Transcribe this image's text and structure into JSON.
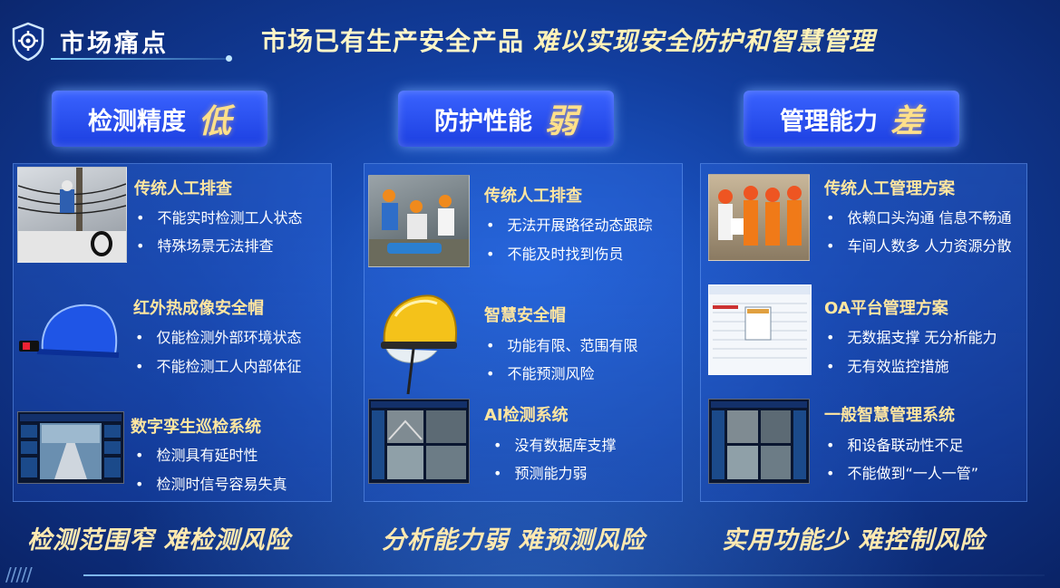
{
  "header": {
    "section_title": "市场痛点",
    "headline_a": "市场已有生产安全产品",
    "headline_b": "难以实现安全防护和智慧管理"
  },
  "columns": [
    {
      "title": "检测精度",
      "accent": "低",
      "items": [
        {
          "title": "传统人工排查",
          "image": "worker-on-pole-photo",
          "bullets": [
            "不能实时检测工人状态",
            "特殊场景无法排查"
          ]
        },
        {
          "title": "红外热成像安全帽",
          "image": "blue-thermal-helmet",
          "bullets": [
            "仅能检测外部环境状态",
            "不能检测工人内部体征"
          ]
        },
        {
          "title": "数字孪生巡检系统",
          "image": "digital-twin-dashboard",
          "bullets": [
            "检测具有延时性",
            "检测时信号容易失真"
          ]
        }
      ],
      "bottom": "检测范围窄 难检测风险"
    },
    {
      "title": "防护性能",
      "accent": "弱",
      "items": [
        {
          "title": "传统人工排查",
          "image": "rescue-workers-photo",
          "bullets": [
            "无法开展路径动态跟踪",
            "不能及时找到伤员"
          ]
        },
        {
          "title": "智慧安全帽",
          "image": "yellow-smart-helmet",
          "bullets": [
            "功能有限、范围有限",
            "不能预测风险"
          ]
        },
        {
          "title": "AI检测系统",
          "image": "ai-monitor-dashboard",
          "bullets": [
            "没有数据库支撑",
            "预测能力弱"
          ]
        }
      ],
      "bottom": "分析能力弱 难预测风险"
    },
    {
      "title": "管理能力",
      "accent": "差",
      "items": [
        {
          "title": "传统人工管理方案",
          "image": "workers-meeting-photo",
          "bullets": [
            "依赖口头沟通 信息不畅通",
            "车间人数多 人力资源分散"
          ]
        },
        {
          "title": "OA平台管理方案",
          "image": "oa-platform-screenshot",
          "bullets": [
            "无数据支撑 无分析能力",
            "无有效监控措施"
          ]
        },
        {
          "title": "一般智慧管理系统",
          "image": "smart-management-dashboard",
          "bullets": [
            "和设备联动性不足",
            "不能做到“一人一管”"
          ]
        }
      ],
      "bottom": "实用功能少 难控制风险"
    }
  ],
  "colors": {
    "accent_yellow": "#ffe08a",
    "panel_blue": "#1c3fe0",
    "background": "#123e9e"
  }
}
